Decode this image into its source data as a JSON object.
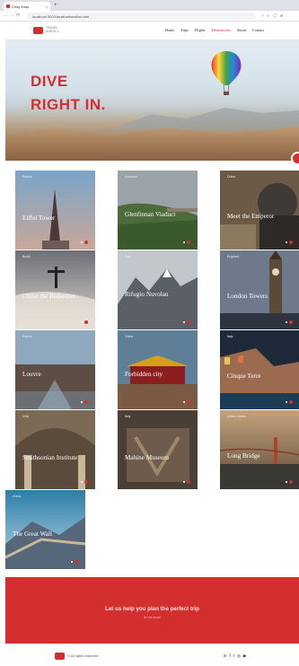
{
  "browser": {
    "tab_title": "Chạy thrav",
    "tab_close": "×",
    "new_tab": "+",
    "url": "localhost:3000/destinations/list.html",
    "nav_glyphs": [
      "←",
      "→",
      "⟳"
    ],
    "ext_glyphs": "☆ ◐ ⬡ ●"
  },
  "header": {
    "logo_text": "TRAVEL AGENCY",
    "nav": [
      {
        "label": "Home",
        "active": false
      },
      {
        "label": "Trips",
        "active": false
      },
      {
        "label": "Flights",
        "active": false
      },
      {
        "label": "Destinations",
        "active": true
      },
      {
        "label": "About",
        "active": false
      },
      {
        "label": "Contact",
        "active": false
      }
    ]
  },
  "hero": {
    "title_line1": "DIVE",
    "title_line2": "RIGHT IN."
  },
  "destinations": [
    {
      "country": "France",
      "name": "Eiffel Tower",
      "theme": "eiffel"
    },
    {
      "country": "Scotland",
      "name": "Glenfinnan Viaduct",
      "theme": "glen"
    },
    {
      "country": "China",
      "name": "Meet the Emperor",
      "theme": "emperor"
    },
    {
      "country": "Brazil",
      "name": "Christ the Redeemer",
      "theme": "christ"
    },
    {
      "country": "Italy",
      "name": "Rifugio Nuvolau",
      "theme": "nuvolau"
    },
    {
      "country": "England",
      "name": "London Towers",
      "theme": "london"
    },
    {
      "country": "France",
      "name": "Louvre",
      "theme": "louvre"
    },
    {
      "country": "China",
      "name": "Forbidden city",
      "theme": "forbidden"
    },
    {
      "country": "Italy",
      "name": "Cinque Terre",
      "theme": "cinque"
    },
    {
      "country": "USA",
      "name": "Smithsonian Institute",
      "theme": "smith"
    },
    {
      "country": "Italy",
      "name": "Mahine Museum",
      "theme": "mahine"
    },
    {
      "country": "United States",
      "name": "Long Bridge",
      "theme": "bridge"
    },
    {
      "country": "China",
      "name": "The Great Wall",
      "theme": "wall"
    }
  ],
  "cta": {
    "title": "Let us help you plan the perfect trip",
    "subtitle": "let me know"
  },
  "footer": {
    "copyright": "© All rights reserved",
    "socials": [
      "in",
      "f",
      "t",
      "◎",
      "▶"
    ]
  },
  "colors": {
    "accent": "#d32f2f"
  }
}
